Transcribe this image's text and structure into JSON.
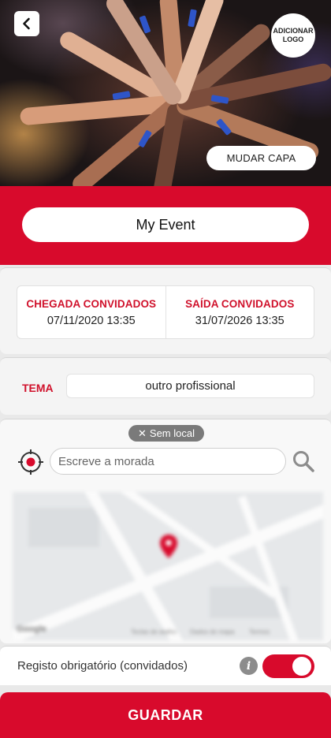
{
  "header": {
    "back_icon": "chevron-left-icon",
    "logo_button_label": "ADICIONAR LOGO",
    "change_cover_label": "MUDAR CAPA"
  },
  "event": {
    "name": "My Event"
  },
  "dates": {
    "arrival_label": "CHEGADA CONVIDADOS",
    "arrival_value": "07/11/2020 13:35",
    "departure_label": "SAÍDA CONVIDADOS",
    "departure_value": "31/07/2026 13:35"
  },
  "theme": {
    "label": "TEMA",
    "value": "outro profissional"
  },
  "location": {
    "chip_label": "Sem local",
    "address_placeholder": "Escreve a morada",
    "map_brand": "Google",
    "map_footer": [
      "Teclas de atalho",
      "Dados do mapa",
      "Termos"
    ]
  },
  "registration": {
    "label": "Registo obrigatório (convidados)",
    "toggle_on": true
  },
  "actions": {
    "save_label": "GUARDAR"
  },
  "colors": {
    "accent": "#d80a2c",
    "label_red": "#d0112b",
    "background": "#e9e9e9"
  }
}
